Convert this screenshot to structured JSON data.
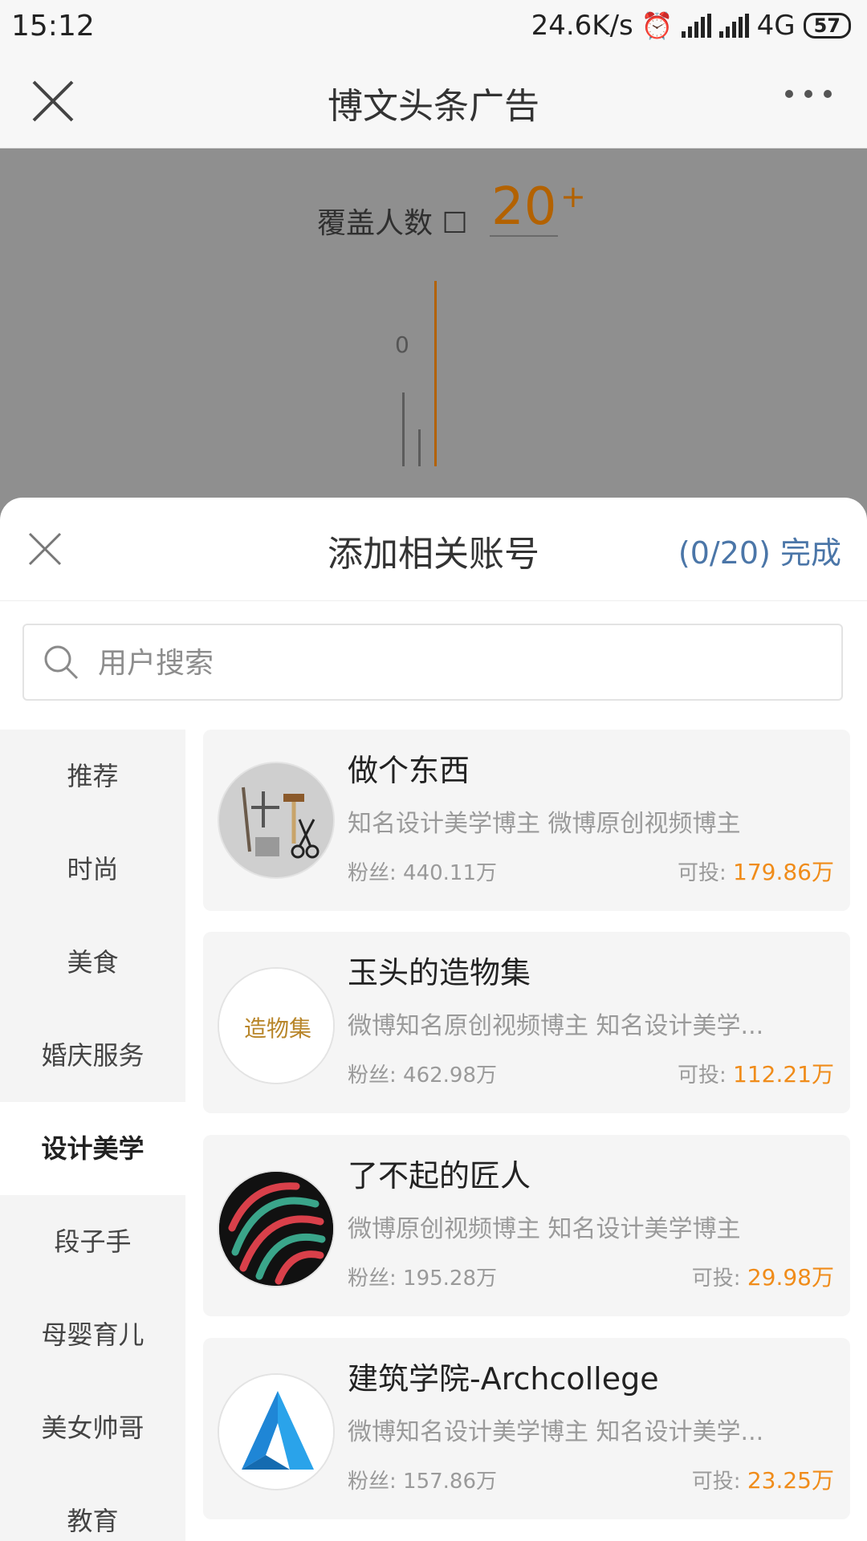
{
  "status_bar": {
    "time": "15:12",
    "speed": "24.6K/s",
    "network": "4G",
    "battery": "57"
  },
  "header": {
    "title": "博文头条广告"
  },
  "background": {
    "coverage_label": "覆盖人数",
    "coverage_value": "20",
    "coverage_suffix": "+",
    "chart_zero_label": "0"
  },
  "sheet": {
    "title": "添加相关账号",
    "count": "(0/20)",
    "done_label": "完成",
    "search_placeholder": "用户搜索"
  },
  "categories": [
    {
      "label": "推荐",
      "active": false
    },
    {
      "label": "时尚",
      "active": false
    },
    {
      "label": "美食",
      "active": false
    },
    {
      "label": "婚庆服务",
      "active": false
    },
    {
      "label": "设计美学",
      "active": true
    },
    {
      "label": "段子手",
      "active": false
    },
    {
      "label": "母婴育儿",
      "active": false
    },
    {
      "label": "美女帅哥",
      "active": false
    },
    {
      "label": "教育",
      "active": false
    }
  ],
  "accounts": [
    {
      "name": "做个东西",
      "desc": "知名设计美学博主 微博原创视频博主",
      "fans_label": "粉丝:",
      "fans": "440.11万",
      "budget_label": "可投:",
      "budget": "179.86万",
      "avatar": "tools-avatar"
    },
    {
      "name": "玉头的造物集",
      "desc": "微博知名原创视频博主 知名设计美学...",
      "fans_label": "粉丝:",
      "fans": "462.98万",
      "budget_label": "可投:",
      "budget": "112.21万",
      "avatar": "calligraphy-avatar"
    },
    {
      "name": "了不起的匠人",
      "desc": "微博原创视频博主 知名设计美学博主",
      "fans_label": "粉丝:",
      "fans": "195.28万",
      "budget_label": "可投:",
      "budget": "29.98万",
      "avatar": "fingerprint-avatar"
    },
    {
      "name": "建筑学院-Archcollege",
      "desc": "微博知名设计美学博主 知名设计美学...",
      "fans_label": "粉丝:",
      "fans": "157.86万",
      "budget_label": "可投:",
      "budget": "23.25万",
      "avatar": "arch-logo-avatar"
    }
  ],
  "calligraphy_text": "造物集",
  "colors": {
    "accent_orange": "#f08c1a",
    "link_blue": "#4b76a8",
    "coverage_orange": "#b36200"
  }
}
